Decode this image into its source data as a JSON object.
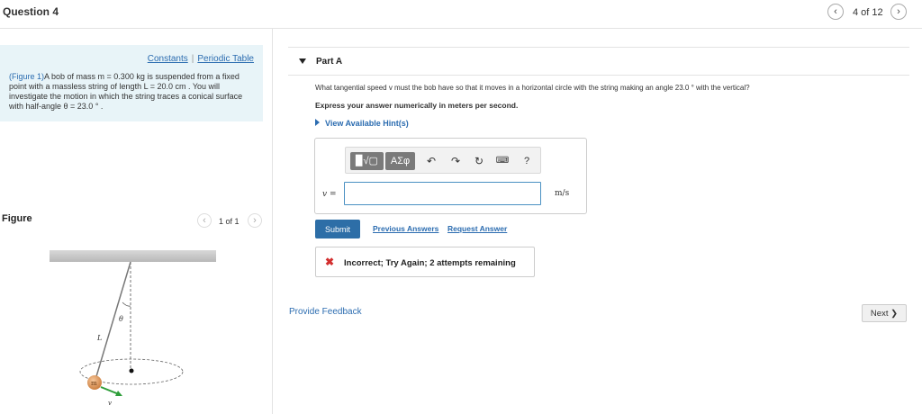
{
  "header": {
    "title": "Question 4",
    "pager_text": "4 of 12",
    "prev_icon": "chevron-left-icon",
    "next_icon": "chevron-right-icon"
  },
  "left": {
    "constants_link": "Constants",
    "periodic_link": "Periodic Table",
    "figure_link": "(Figure 1)",
    "problem_text": "A bob of mass m = 0.300 kg is suspended from a fixed point with a massless string of length L = 20.0 cm . You will investigate the motion in which the string traces a conical surface with half-angle θ = 23.0 ° .",
    "figure_label": "Figure",
    "figure_pager": "1 of 1",
    "figure": {
      "label_theta": "θ",
      "label_L": "L",
      "label_m": "m",
      "label_v": "v"
    }
  },
  "part": {
    "title": "Part A",
    "question": "What tangential speed v must the bob have so that it moves in a horizontal circle with the string making an angle 23.0 ° with the vertical?",
    "instruction": "Express your answer numerically in meters per second.",
    "hint_link": "View Available Hint(s)",
    "toolbar": {
      "templates_label": "▉√▢",
      "greek_label": "ΑΣφ",
      "help_label": "?"
    },
    "var_label": "v =",
    "input_value": "",
    "unit": "m/s",
    "submit_label": "Submit",
    "previous_answers": "Previous Answers",
    "request_answer": "Request Answer",
    "feedback_text": "Incorrect; Try Again; 2 attempts remaining"
  },
  "footer": {
    "provide_feedback": "Provide Feedback",
    "next_label": "Next ❯"
  },
  "colors": {
    "accent": "#2b6cb0",
    "submit": "#2d6ea7",
    "panel_bg": "#e8f4f8",
    "error": "#d32f2f",
    "bob": "#e8a060",
    "velocity": "#2e9e3a"
  }
}
